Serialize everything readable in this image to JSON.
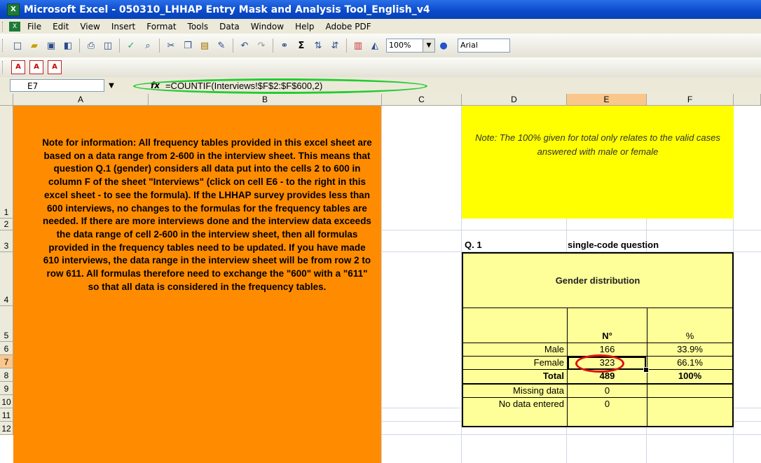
{
  "window": {
    "title": "Microsoft Excel - 050310_LHHAP Entry Mask and Analysis Tool_English_v4",
    "app_icon": "excel-icon"
  },
  "menu": [
    "File",
    "Edit",
    "View",
    "Insert",
    "Format",
    "Tools",
    "Data",
    "Window",
    "Help",
    "Adobe PDF"
  ],
  "toolbar": {
    "zoom": "100%",
    "font": "Arial",
    "icons": [
      "new-icon",
      "open-icon",
      "save-icon",
      "permission-icon",
      "print-icon",
      "print-preview-icon",
      "spelling-icon",
      "research-icon",
      "cut-icon",
      "copy-icon",
      "paste-icon",
      "format-painter-icon",
      "undo-icon",
      "redo-icon",
      "hyperlink-icon",
      "autosum-icon",
      "sort-ascending-icon",
      "sort-descending-icon",
      "chart-wizard-icon",
      "drawing-icon"
    ]
  },
  "formula_bar": {
    "cell_ref": "E7",
    "fx": "fx",
    "formula": "=COUNTIF(Interviews!$F$2:$F$600,2)"
  },
  "columns": [
    "A",
    "B",
    "C",
    "D",
    "E",
    "F"
  ],
  "rows": [
    "1",
    "2",
    "3",
    "4",
    "5",
    "6",
    "7",
    "8",
    "9",
    "10",
    "11",
    "12"
  ],
  "note_orange": "Note for information: All frequency tables provided in this excel sheet are based on a data range from 2-600 in the interview sheet. This means that question Q.1 (gender) considers all data put into the cells 2 to 600 in column F of the sheet \"Interviews\" (click on cell E6 - to the right in this excel sheet - to see the formula). If the LHHAP survey provides less than 600 interviews, no changes to the formulas for the frequency tables are needed. If there are more interviews done and the interview data exceeds the data range of cell 2-600 in the interview sheet, then all formulas provided in the frequency tables need to be updated. If you have made 610 interviews, the data range in the interview sheet will be from row 2 to row 611. All formulas therefore need to exchange the \"600\" with a \"611\" so that all data is considered in the frequency tables.",
  "note_yellow": "Note: The 100% given for total only relates to the valid cases answered with male or female",
  "question": {
    "label": "Q. 1",
    "type": "single-code question"
  },
  "table": {
    "title": "Gender distribution",
    "head_n": "N°",
    "head_pct": "%",
    "rows": [
      {
        "label": "Male",
        "n": "166",
        "pct": "33.9%"
      },
      {
        "label": "Female",
        "n": "323",
        "pct": "66.1%"
      },
      {
        "label": "Total",
        "n": "489",
        "pct": "100%"
      },
      {
        "label": "Missing data",
        "n": "0",
        "pct": ""
      },
      {
        "label": "No data entered",
        "n": "0",
        "pct": ""
      }
    ]
  },
  "colors": {
    "orange": "#ff8c00",
    "yellow": "#ffff00",
    "table_fill": "#ffff99",
    "highlight_green": "#22cc33",
    "highlight_red": "#e01010"
  }
}
